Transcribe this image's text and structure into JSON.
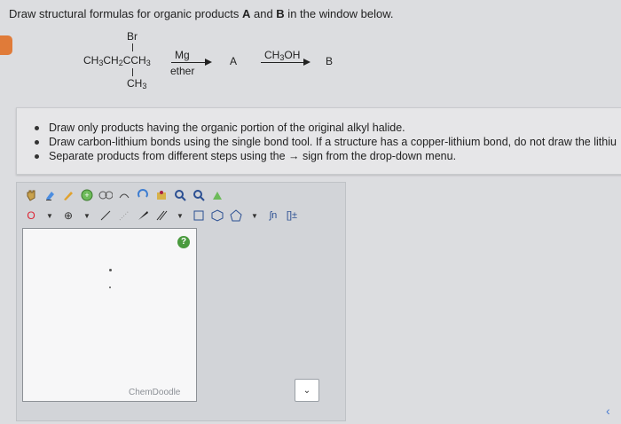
{
  "question": {
    "prefix": "Draw structural formulas for organic products ",
    "a": "A",
    "and": " and ",
    "b": "B",
    "suffix": " in the window below."
  },
  "reaction": {
    "br": "Br",
    "main_chain": "CH3CH2CCH3",
    "ch3_bottom": "CH3",
    "reagent1_top": "Mg",
    "reagent1_bottom": "ether",
    "product_a": "A",
    "reagent2": "CH3OH",
    "product_b": "B"
  },
  "instructions": [
    "Draw only products having the organic portion of the original alkyl halide.",
    "Draw carbon-lithium bonds using the single bond tool. If a structure has a copper-lithium bond, do not draw the lithiu",
    "Separate products from different steps using the → sign from the drop-down menu."
  ],
  "toolbar": {
    "row1_icons": [
      "hand-icon",
      "eraser-icon",
      "pencil-icon",
      "copy-icon",
      "flask-icon",
      "cut-icon",
      "rotate-icon",
      "clean-icon",
      "zoom-in-icon",
      "zoom-out-icon",
      "template-icon"
    ],
    "row2_icons": [
      "atom-label",
      "plus-charge-icon",
      "single-bond-icon",
      "wedge-bond-icon",
      "double-bond-icon",
      "ring-icon",
      "hexagon-icon",
      "pentagon-icon",
      "sn-icon",
      "bracket-icon"
    ],
    "atom_label": "O",
    "charge_label": "⊕"
  },
  "canvas": {
    "brand": "ChemDoodle",
    "help": "?"
  },
  "dropdown": {
    "value": ""
  }
}
